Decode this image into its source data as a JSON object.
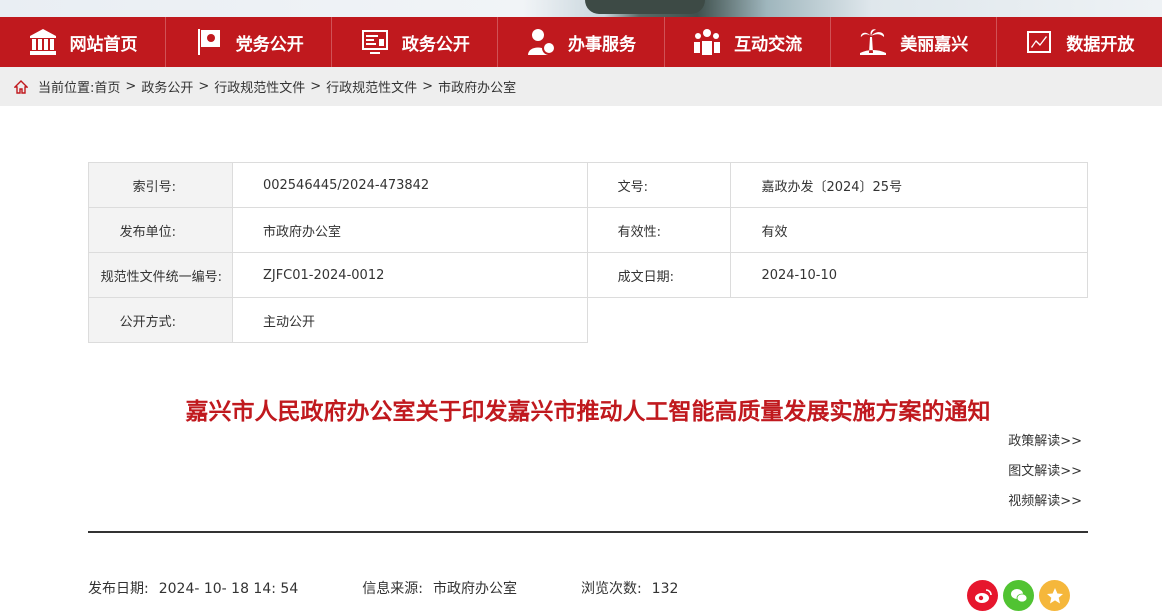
{
  "nav": {
    "items": [
      {
        "label": "网站首页",
        "icon": "government-building-icon"
      },
      {
        "label": "党务公开",
        "icon": "party-flag-icon"
      },
      {
        "label": "政务公开",
        "icon": "document-screen-icon"
      },
      {
        "label": "办事服务",
        "icon": "service-person-icon"
      },
      {
        "label": "互动交流",
        "icon": "people-group-icon"
      },
      {
        "label": "美丽嘉兴",
        "icon": "palm-tree-icon"
      },
      {
        "label": "数据开放",
        "icon": "data-chart-icon"
      }
    ]
  },
  "breadcrumb": {
    "prefix": "当前位置:",
    "items": [
      "首页",
      "政务公开",
      "行政规范性文件",
      "行政规范性文件",
      "市政府办公室"
    ],
    "separator": ">"
  },
  "meta": {
    "index_label": "索引号:",
    "index_value": "002546445/2024-473842",
    "docno_label": "文号:",
    "docno_value": "嘉政办发〔2024〕25号",
    "publisher_label": "发布单位:",
    "publisher_value": "市政府办公室",
    "validity_label": "有效性:",
    "validity_value": "有效",
    "code_label": "规范性文件统一编号:",
    "code_value": "ZJFC01-2024-0012",
    "date_label": "成文日期:",
    "date_value": "2024-10-10",
    "open_label": "公开方式:",
    "open_value": "主动公开"
  },
  "document": {
    "title": "嘉兴市人民政府办公室关于印发嘉兴市推动人工智能高质量发展实施方案的通知"
  },
  "interpretations": [
    "政策解读>>",
    "图文解读>>",
    "视频解读>>"
  ],
  "info": {
    "publish_label": "发布日期:",
    "publish_value": "2024- 10- 18 14: 54",
    "source_label": "信息来源:",
    "source_value": "市政府办公室",
    "views_label": "浏览次数:",
    "views_value": "132"
  },
  "share": {
    "weibo": {
      "icon": "weibo-icon",
      "color": "#e6162d"
    },
    "wechat": {
      "icon": "wechat-icon",
      "color": "#51c332"
    },
    "qzone": {
      "icon": "qzone-star-icon",
      "color": "#f5b73b"
    }
  },
  "colors": {
    "brand_red": "#c0191e",
    "crumb_bg": "#eeeeee",
    "table_label_bg": "#f3f3f3"
  }
}
